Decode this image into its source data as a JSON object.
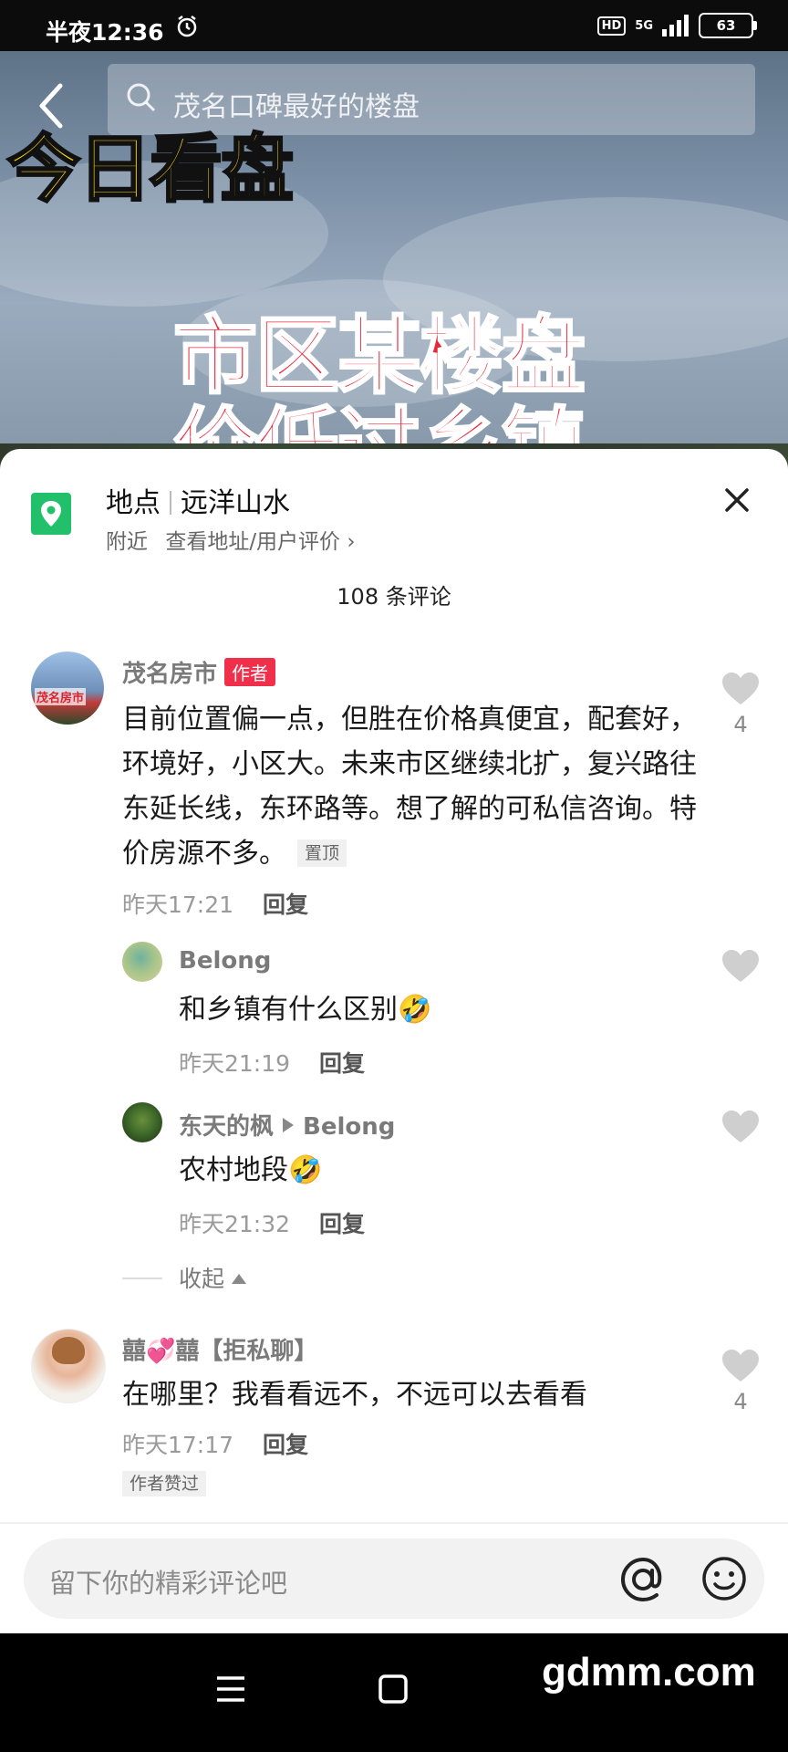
{
  "status_bar": {
    "time": "半夜12:36",
    "network": "5G",
    "hd": "HD",
    "battery": "63"
  },
  "video": {
    "search_query": "茂名口碑最好的楼盘",
    "overlay_title": "今日看盘",
    "overlay_headline_line1": "市区某楼盘",
    "overlay_headline_line2": "价低过乡镇"
  },
  "location": {
    "label": "地点",
    "name": "远洋山水",
    "nearby": "附近",
    "link": "查看地址/用户评价 ›"
  },
  "comment_count": "108 条评论",
  "comments": [
    {
      "user": "茂名房市",
      "tag": "作者",
      "text": "目前位置偏一点，但胜在价格真便宜，配套好，环境好，小区大。未来市区继续北扩，复兴路往东延长线，东环路等。想了解的可私信咨询。特价房源不多。",
      "pin": "置顶",
      "time": "昨天17:21",
      "reply": "回复",
      "likes": "4",
      "avatar_text": "茂名房市"
    },
    {
      "user": "Belong",
      "text": "和乡镇有什么区别🤣",
      "time": "昨天21:19",
      "reply": "回复"
    },
    {
      "user": "东天的枫",
      "reply_to": "Belong",
      "text": "农村地段🤣",
      "time": "昨天21:32",
      "reply": "回复"
    },
    {
      "user": "囍💞囍【拒私聊】",
      "text": "在哪里？我看看远不，不远可以去看看",
      "time": "昨天17:17",
      "reply": "回复",
      "likes": "4",
      "liked_tag": "作者赞过"
    }
  ],
  "collapse_label": "收起",
  "input_placeholder": "留下你的精彩评论吧",
  "watermark": "gdmm.com",
  "colors": {
    "author_tag": "#f0304b",
    "location_icon": "#22c06b"
  }
}
